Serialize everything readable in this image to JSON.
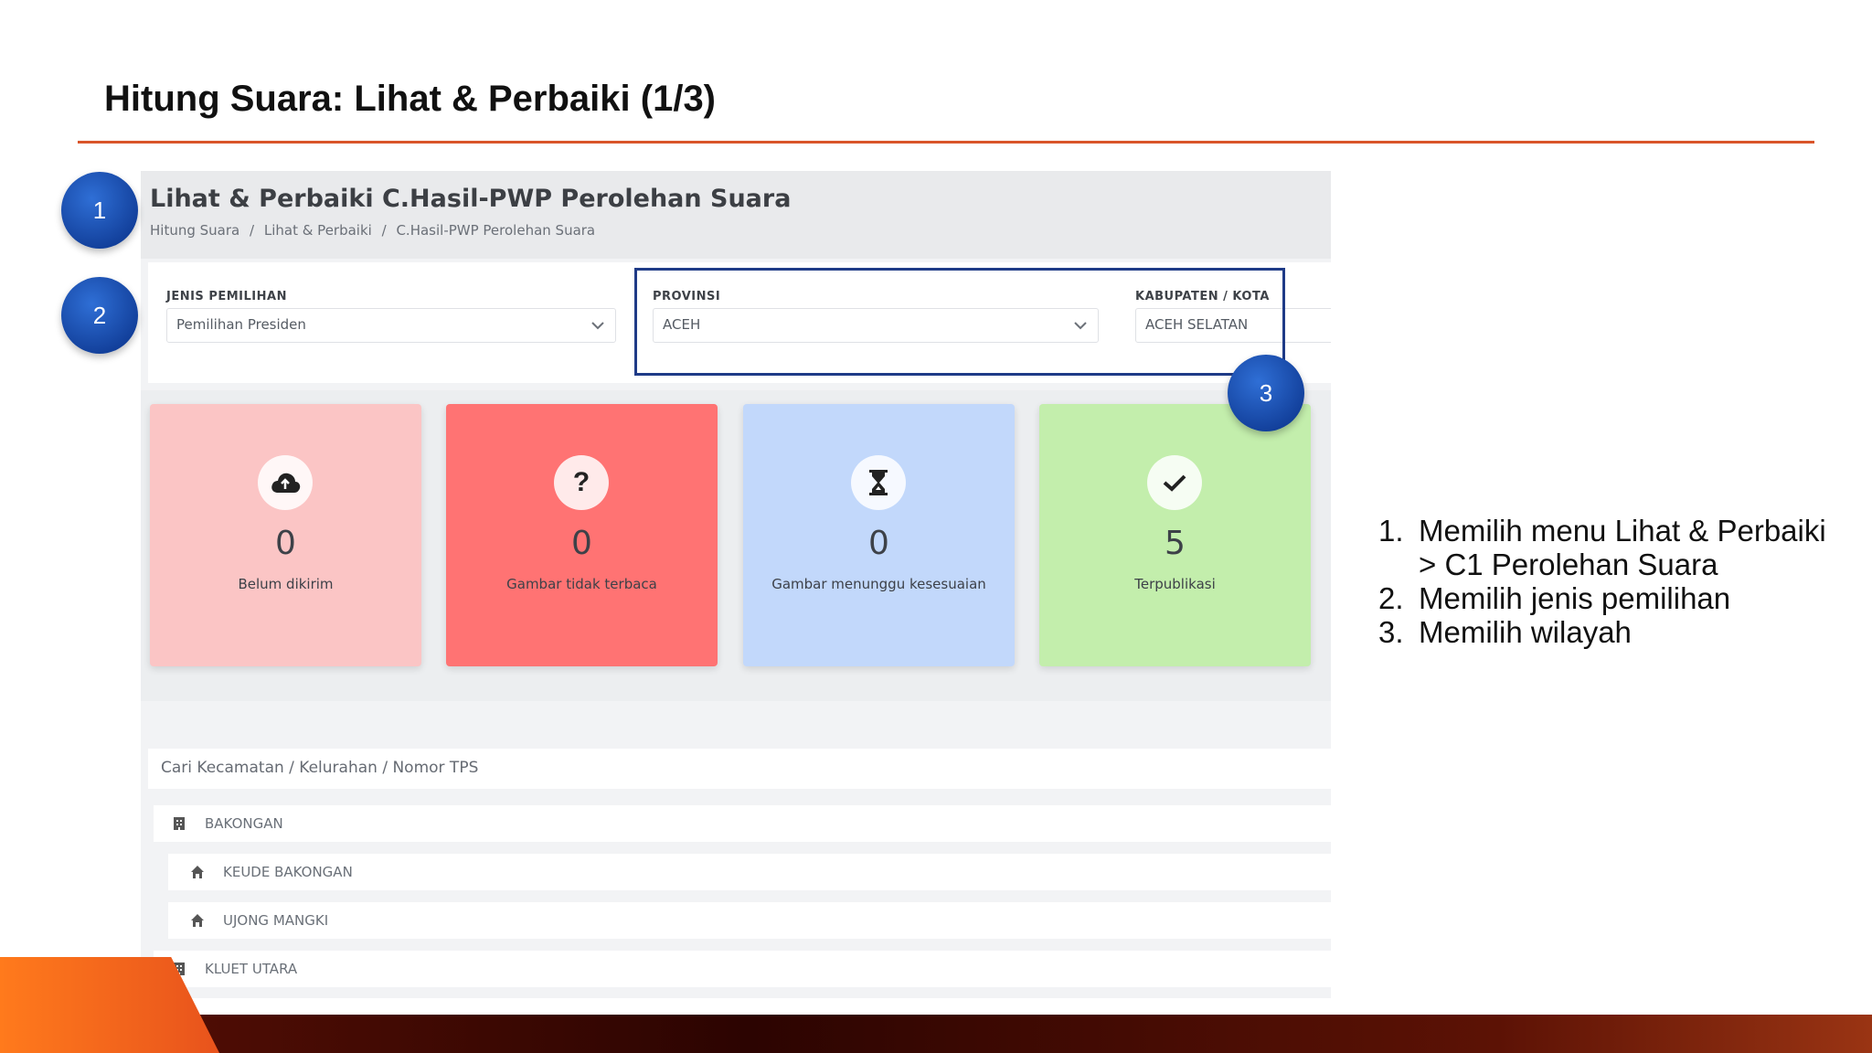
{
  "slide": {
    "title": "Hitung Suara: Lihat & Perbaiki (1/3)"
  },
  "app": {
    "title": "Lihat & Perbaiki C.Hasil-PWP Perolehan Suara",
    "breadcrumb": [
      "Hitung Suara",
      "/",
      "Lihat & Perbaiki",
      "/",
      "C.Hasil-PWP Perolehan Suara"
    ],
    "filters": {
      "jenis_label": "JENIS PEMILIHAN",
      "jenis_value": "Pemilihan Presiden",
      "provinsi_label": "PROVINSI",
      "provinsi_value": "ACEH",
      "kabupaten_label": "KABUPATEN / KOTA",
      "kabupaten_value": "ACEH SELATAN"
    },
    "stats": [
      {
        "value": "0",
        "label": "Belum dikirim",
        "icon": "cloud-upload-icon",
        "color": "#fbc5c5"
      },
      {
        "value": "0",
        "label": "Gambar tidak terbaca",
        "icon": "question-icon",
        "color": "#ff7373"
      },
      {
        "value": "0",
        "label": "Gambar menunggu kesesuaian",
        "icon": "hourglass-icon",
        "color": "#c2d8fb"
      },
      {
        "value": "5",
        "label": "Terpublikasi",
        "icon": "check-icon",
        "color": "#c3eeac"
      }
    ],
    "search_placeholder": "Cari Kecamatan / Kelurahan / Nomor TPS",
    "locations": [
      {
        "name": "BAKONGAN",
        "level": "kecamatan"
      },
      {
        "name": "KEUDE BAKONGAN",
        "level": "kelurahan"
      },
      {
        "name": "UJONG MANGKI",
        "level": "kelurahan"
      },
      {
        "name": "KLUET UTARA",
        "level": "kecamatan"
      }
    ]
  },
  "badges": [
    "1",
    "2",
    "3"
  ],
  "notes": [
    {
      "num": "1.",
      "line1": "Memilih menu Lihat & Perbaiki",
      "line2": "> C1 Perolehan Suara"
    },
    {
      "num": "2.",
      "line1": "Memilih jenis pemilihan"
    },
    {
      "num": "3.",
      "line1": "Memilih wilayah"
    }
  ]
}
